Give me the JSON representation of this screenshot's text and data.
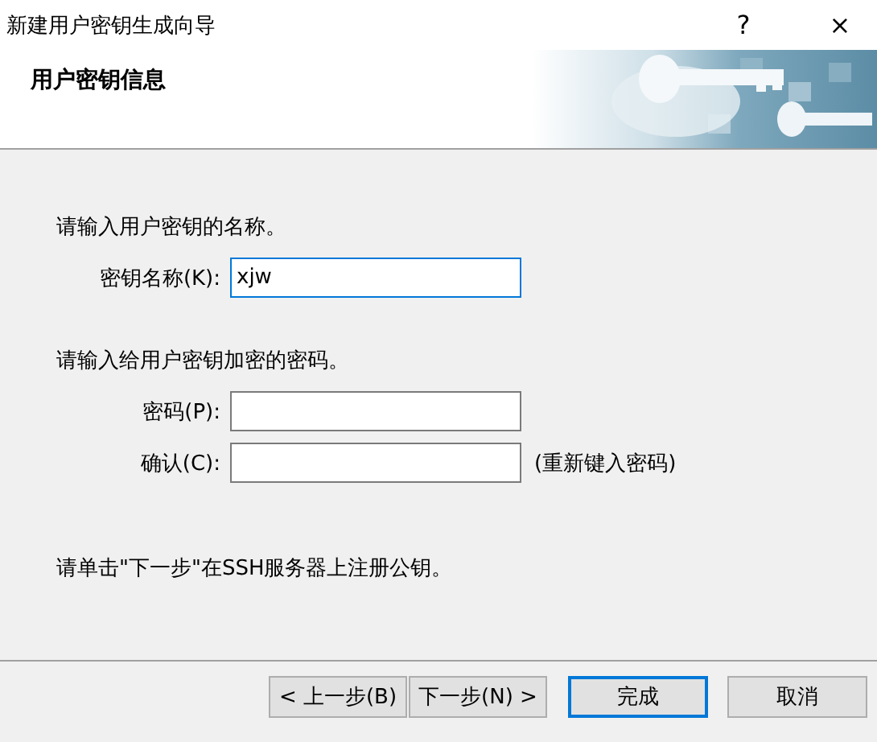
{
  "window": {
    "title": "新建用户密钥生成向导",
    "help": "?",
    "close": "×"
  },
  "header": {
    "title": "用户密钥信息",
    "kind": "picture"
  },
  "sections": [
    {
      "prompt": "请输入用户密钥的名称。",
      "fields": [
        {
          "label": "密钥名称(K):",
          "value": "xjw",
          "focused": true
        }
      ]
    },
    {
      "prompt": "请输入给用户密钥加密的密码。",
      "fields": [
        {
          "label": "密码(P):",
          "focused": false
        },
        {
          "label": "确认(C):",
          "focused": false,
          "hint": "(重新键入密码)"
        }
      ]
    }
  ],
  "note": "请单击\"下一步\"在SSH服务器上注册公钥。",
  "buttons": [
    {
      "label": "< 上一步(B)",
      "default": false
    },
    {
      "label": "下一步(N) >",
      "default": false
    },
    {
      "label": "完成",
      "default": true
    },
    {
      "label": "取消",
      "default": false
    }
  ]
}
